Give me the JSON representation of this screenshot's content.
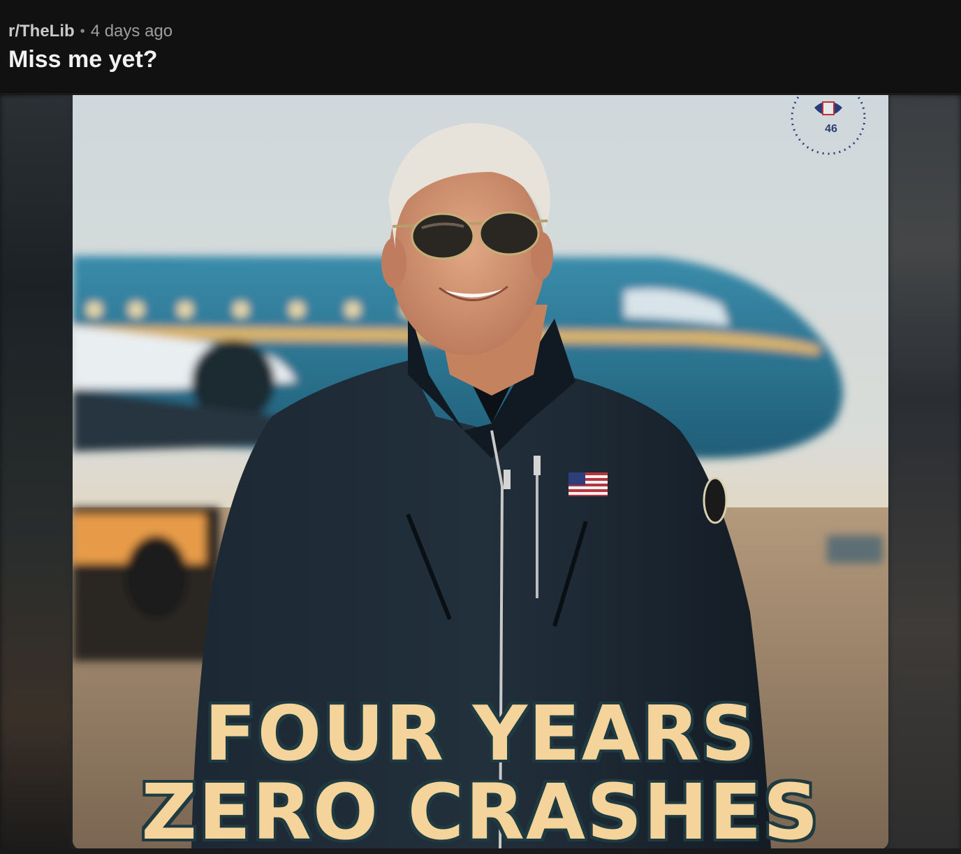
{
  "post": {
    "subreddit": "r/TheLib",
    "separator": "•",
    "timestamp": "4 days ago",
    "title": "Miss me yet?"
  },
  "image": {
    "seal_number": "46",
    "caption_line1": "FOUR YEARS",
    "caption_line2": "ZERO CRASHES"
  },
  "colors": {
    "header_bg": "#111111",
    "caption_fill": "#f4d49a",
    "caption_outline": "#1f3a40",
    "plane_body": "#2f7e9a"
  }
}
